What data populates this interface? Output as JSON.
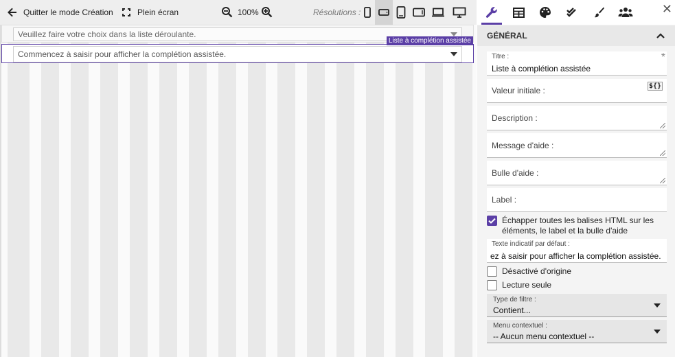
{
  "toolbar": {
    "quit_label": "Quitter le mode Création",
    "fullscreen_label": "Plein écran",
    "zoom_value": "100%",
    "resolutions_label": "Résolutions :",
    "resolutions": [
      {
        "icon": "phone-portrait-icon"
      },
      {
        "icon": "phone-landscape-icon",
        "active": true
      },
      {
        "icon": "tablet-portrait-icon"
      },
      {
        "icon": "tablet-landscape-icon"
      },
      {
        "icon": "laptop-icon"
      },
      {
        "icon": "desktop-icon"
      }
    ]
  },
  "canvas": {
    "question1_placeholder": "Veuillez faire votre choix dans la liste déroulante.",
    "question2_placeholder": "Commencez à saisir pour afficher la complétion assistée.",
    "question2_tag": "Liste à complétion assistée"
  },
  "panel": {
    "tabs": [
      "wrench-icon",
      "table-icon",
      "palette-icon",
      "double-check-icon",
      "brush-icon",
      "users-icon"
    ],
    "section_title": "GÉNÉRAL",
    "title_label": "Titre :",
    "title_value": "Liste à complétion assistée",
    "required_mark": "*",
    "initial_value_label": "Valeur initiale :",
    "expression_label": "${}",
    "description_label": "Description :",
    "help_message_label": "Message d'aide :",
    "tooltip_label": "Bulle d'aide :",
    "label_label": "Label :",
    "escape_html_label": "Échapper toutes les balises HTML sur les éléments, le label et la bulle d'aide",
    "escape_html_checked": true,
    "placeholder_label": "Texte indicatif par défaut :",
    "placeholder_value": "ez à saisir pour afficher la complétion assistée.",
    "disabled_label": "Désactivé d'origine",
    "disabled_checked": false,
    "readonly_label": "Lecture seule",
    "readonly_checked": false,
    "filter_type_label": "Type de filtre :",
    "filter_type_value": "Contient...",
    "context_menu_label": "Menu contextuel :",
    "context_menu_value": "-- Aucun menu contextuel --"
  },
  "colors": {
    "accent": "#5b3fa6"
  }
}
